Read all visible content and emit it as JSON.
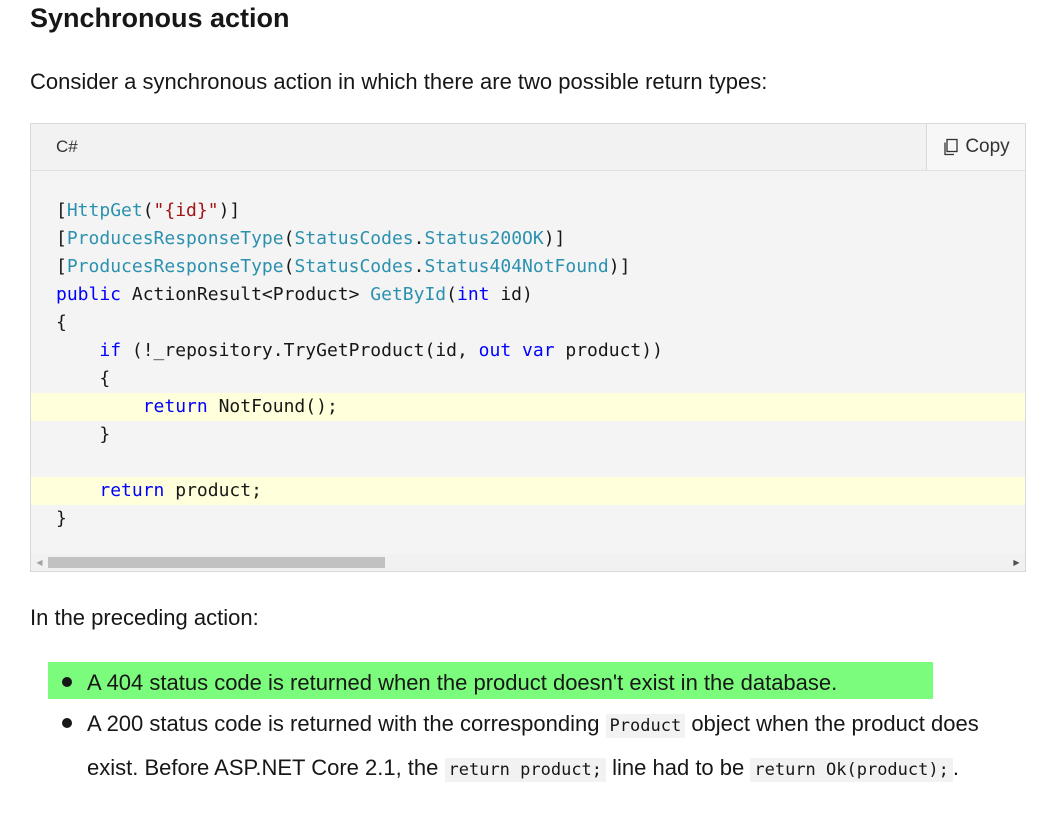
{
  "heading": "Synchronous action",
  "intro": "Consider a synchronous action in which there are two possible return types:",
  "code": {
    "language": "C#",
    "copy_label": "Copy",
    "lines": [
      "[HttpGet(\"{id}\")]",
      "[ProducesResponseType(StatusCodes.Status200OK)]",
      "[ProducesResponseType(StatusCodes.Status404NotFound)]",
      "public ActionResult<Product> GetById(int id)",
      "{",
      "    if (!_repository.TryGetProduct(id, out var product))",
      "    {",
      "        return NotFound();",
      "    }",
      "",
      "    return product;",
      "}"
    ],
    "highlighted_lines": [
      7,
      10
    ]
  },
  "after_code": "In the preceding action:",
  "bullets": {
    "b1": "A 404 status code is returned when the product doesn't exist in the database.",
    "b2_pre": "A 200 status code is returned with the corresponding ",
    "b2_code1": "Product",
    "b2_mid": " object when the product does exist. Before ASP.NET Core 2.1, the ",
    "b2_code2": "return product;",
    "b2_mid2": " line had to be ",
    "b2_code3": "return Ok(product);",
    "b2_end": "."
  },
  "colors": {
    "keyword": "#0000ff",
    "type": "#2b91af",
    "string": "#a31515",
    "line_highlight": "#ffffdb",
    "bullet_highlight": "#7cfc7c"
  }
}
